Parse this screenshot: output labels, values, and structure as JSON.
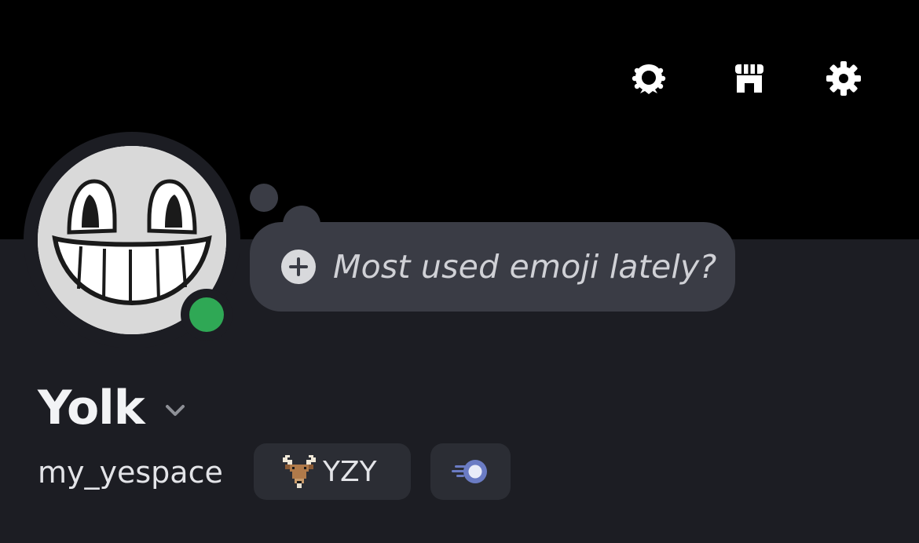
{
  "header": {
    "icons": [
      {
        "name": "nitro-laurel-icon",
        "color": "#ffffff"
      },
      {
        "name": "shop-icon",
        "color": "#ffffff"
      },
      {
        "name": "settings-gear-icon",
        "color": "#ffffff"
      }
    ]
  },
  "profile": {
    "avatar": {
      "description_icon": "smiling-face-avatar"
    },
    "status": {
      "state": "online",
      "color": "#2fa855"
    },
    "status_prompt": {
      "icon": "add-icon",
      "placeholder": "Most used emoji lately?"
    },
    "display_name": "Yolk",
    "username": "my_yespace",
    "guild_tag": {
      "icon": "goat-icon",
      "label": "YZY"
    },
    "boost_badge": {
      "icon": "nitro-boost-icon"
    }
  },
  "colors": {
    "banner": "#000000",
    "background": "#1c1d23",
    "bubble": "#3a3c45",
    "badge": "#2b2d34",
    "online": "#2fa855"
  }
}
